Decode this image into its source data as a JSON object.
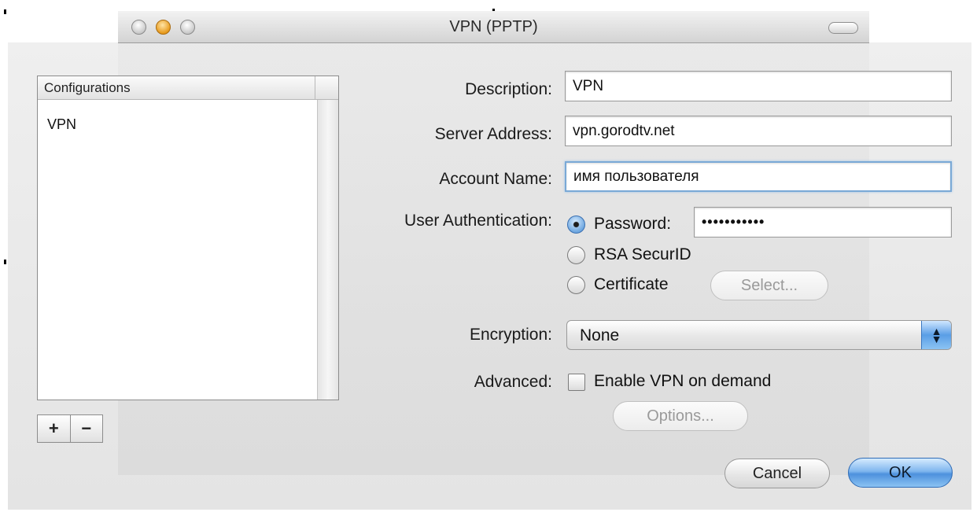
{
  "window": {
    "title": "VPN (PPTP)"
  },
  "configurations": {
    "header": "Configurations",
    "items": [
      "VPN"
    ],
    "add_label": "+",
    "remove_label": "−"
  },
  "form": {
    "description": {
      "label": "Description:",
      "value": "VPN"
    },
    "server_address": {
      "label": "Server Address:",
      "value": "vpn.gorodtv.net"
    },
    "account_name": {
      "label": "Account Name:",
      "value": "имя пользователя"
    },
    "user_authentication": {
      "label": "User Authentication:",
      "options": [
        "Password:",
        "RSA SecurID",
        "Certificate"
      ],
      "selected": "Password:",
      "password_value": "•••••••••••",
      "select_button": "Select..."
    },
    "encryption": {
      "label": "Encryption:",
      "value": "None"
    },
    "advanced": {
      "label": "Advanced:",
      "checkbox_label": "Enable VPN on demand",
      "checked": false
    },
    "options_button": "Options..."
  },
  "buttons": {
    "cancel": "Cancel",
    "ok": "OK"
  },
  "colors": {
    "accent": "#5a9ee6",
    "window_bg": "#ececec"
  }
}
